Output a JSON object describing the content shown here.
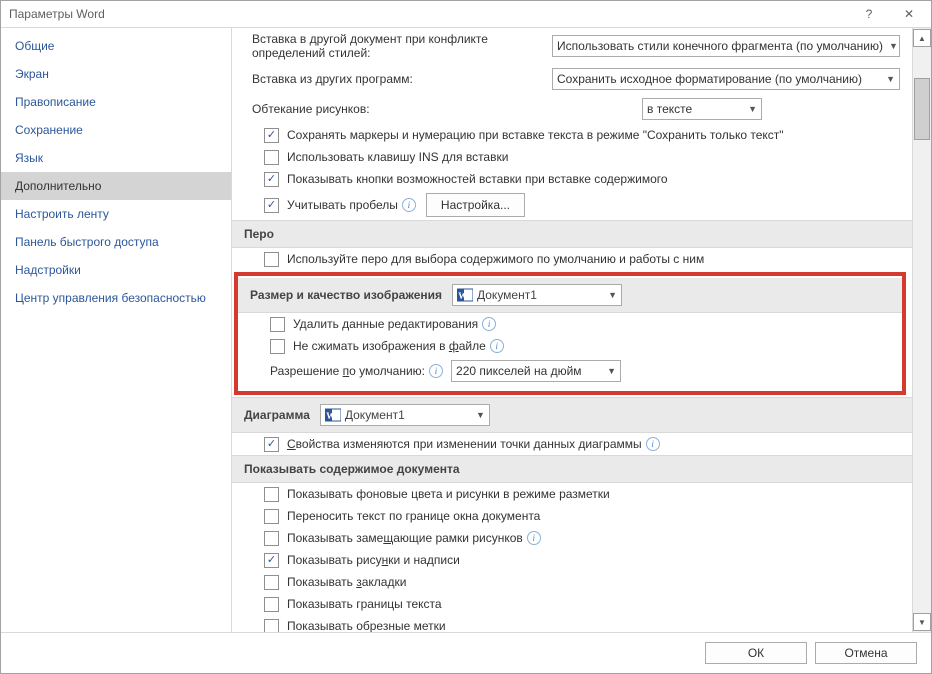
{
  "window": {
    "title": "Параметры Word",
    "help_tooltip": "?",
    "close_tooltip": "✕"
  },
  "nav": {
    "items": [
      "Общие",
      "Экран",
      "Правописание",
      "Сохранение",
      "Язык",
      "Дополнительно",
      "Настроить ленту",
      "Панель быстрого доступа",
      "Надстройки",
      "Центр управления безопасностью"
    ],
    "active_index": 5
  },
  "paste": {
    "row1_label": "Вставка в другой документ при конфликте определений стилей:",
    "row1_value": "Использовать стили конечного фрагмента (по умолчанию)",
    "row2_label": "Вставка из других программ:",
    "row2_value": "Сохранить исходное форматирование (по умолчанию)",
    "wrap_label": "Обтекание рисунков:",
    "wrap_value": "в тексте",
    "chk1": "Сохранять маркеры и нумерацию при вставке текста в режиме \"Сохранить только текст\"",
    "chk2": "Использовать клавишу INS для вставки",
    "chk3": "Показывать кнопки возможностей вставки при вставке содержимого",
    "chk4": "Учитывать пробелы",
    "settings_btn": "Настройка..."
  },
  "pen": {
    "header": "Перо",
    "chk1": "Используйте перо для выбора содержимого по умолчанию и работы с ним"
  },
  "image": {
    "header": "Размер и качество изображения",
    "doc": "Документ1",
    "chk1": "Удалить данные редактирования",
    "chk2_pre": "Не сжимать изображения в ",
    "chk2_u": "ф",
    "chk2_post": "айле",
    "res_pre": "Разрешение ",
    "res_u": "п",
    "res_post": "о умолчанию:",
    "res_value": "220 пикселей на дюйм"
  },
  "chart": {
    "header": "Диаграмма",
    "doc": "Документ1",
    "chk1_u": "С",
    "chk1_post": "войства изменяются при изменении точки данных диаграммы"
  },
  "show": {
    "header": "Показывать содержимое документа",
    "items": [
      {
        "text": "Показывать фоновые цвета и рисунки в режиме разметки",
        "checked": false
      },
      {
        "text": "Переносить текст по границе окна документа",
        "checked": false
      },
      {
        "pre": "Показывать заме",
        "u": "щ",
        "post": "ающие рамки рисунков",
        "checked": false,
        "info": true
      },
      {
        "pre": "Показывать рису",
        "u": "н",
        "post": "ки и надписи",
        "checked": true
      },
      {
        "pre": "Показывать ",
        "u": "з",
        "post": "акладки",
        "checked": false
      },
      {
        "text": "Показывать границы текста",
        "checked": false
      },
      {
        "text": "Показывать обрезные метки",
        "checked": false
      }
    ]
  },
  "footer": {
    "ok": "ОК",
    "cancel": "Отмена"
  }
}
